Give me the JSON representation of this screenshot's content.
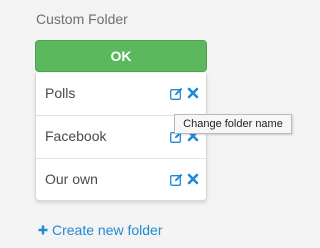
{
  "panel": {
    "title": "Custom Folder",
    "ok_label": "OK"
  },
  "folders": [
    {
      "name": "Polls",
      "edit_icon": "edit-icon",
      "remove_icon": "remove-icon"
    },
    {
      "name": "Facebook",
      "edit_icon": "edit-icon",
      "remove_icon": "remove-icon"
    },
    {
      "name": "Our own",
      "edit_icon": "edit-icon",
      "remove_icon": "remove-icon"
    }
  ],
  "tooltip": {
    "text": "Change folder name"
  },
  "create_link": {
    "icon": "plus-icon",
    "label": "Create new folder"
  },
  "colors": {
    "ok_button": "#5cb85c",
    "link": "#1f8ad6",
    "icon": "#1f8ad6"
  }
}
